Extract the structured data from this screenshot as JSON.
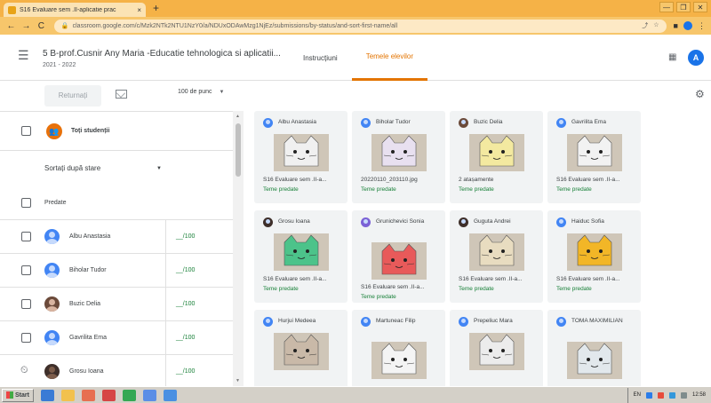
{
  "browser": {
    "tab_title": "S16 Evaluare sem .II-aplicatie prac",
    "tab_close": "×",
    "new_tab": "+",
    "window_controls": [
      "—",
      "❐",
      "✕"
    ],
    "url": "classroom.google.com/c/Mzk2NTk2NTU1NzY0/a/NDUxODAwMzg1NjEz/submissions/by-status/and-sort-first-name/all",
    "nav": [
      "←",
      "→",
      "C"
    ]
  },
  "header": {
    "course_title": "5 B-prof.Cusnir Any Maria -Educatie tehnologica si aplicatii...",
    "course_year": "2021 - 2022",
    "tabs": [
      {
        "label": "Instrucțiuni",
        "active": false
      },
      {
        "label": "Temele elevilor",
        "active": true
      }
    ],
    "avatar_letter": "A",
    "accent_color": "#e37400"
  },
  "toolbar": {
    "return_label": "Returnați",
    "points_value": "100 de punc"
  },
  "left_panel": {
    "all_students_label": "Toți studenții",
    "sort_label": "Sortați după stare",
    "section_label": "Predate",
    "students": [
      {
        "name": "Albu Anastasia",
        "grade": "__/100",
        "avatar": "default"
      },
      {
        "name": "Biholar Tudor",
        "grade": "__/100",
        "avatar": "default"
      },
      {
        "name": "Buzic Delia",
        "grade": "__/100",
        "avatar": "photo"
      },
      {
        "name": "Gavrilita Ema",
        "grade": "__/100",
        "avatar": "default"
      },
      {
        "name": "Grosu Ioana",
        "grade": "__/100",
        "avatar": "dark"
      }
    ]
  },
  "cards": [
    {
      "name": "Albu Anastasia",
      "file": "S16 Evaluare sem .II-a...",
      "status": "Teme predate",
      "avatar": "default",
      "paper": "#f0f0f0"
    },
    {
      "name": "Biholar Tudor",
      "file": "20220110_203110.jpg",
      "status": "Teme predate",
      "avatar": "default",
      "paper": "#e8e0f0"
    },
    {
      "name": "Buzic Delia",
      "file": "2 atașamente",
      "status": "Teme predate",
      "avatar": "photo",
      "paper": "#f3e9a0"
    },
    {
      "name": "Gavrilita Ema",
      "file": "S16 Evaluare sem .II-a...",
      "status": "Teme predate",
      "avatar": "default",
      "paper": "#f2f2f2"
    },
    {
      "name": "Grosu Ioana",
      "file": "S16 Evaluare sem .II-a...",
      "status": "Teme predate",
      "avatar": "dark",
      "paper": "#4cc38a"
    },
    {
      "name": "Grunichevici Sonia",
      "file": "S16 Evaluare sem .II-a...",
      "status": "Teme predate",
      "avatar": "purple",
      "paper": "#e85a5a"
    },
    {
      "name": "Guguta Andrei",
      "file": "S16 Evaluare sem .II-a...",
      "status": "Teme predate",
      "avatar": "dark",
      "paper": "#e8dcc0"
    },
    {
      "name": "Haiduc Sofia",
      "file": "S16 Evaluare sem .II-a...",
      "status": "Teme predate",
      "avatar": "default",
      "paper": "#f2b627"
    },
    {
      "name": "Hurjui Medeea",
      "file": "",
      "status": "",
      "avatar": "default",
      "paper": "#c9b9a8"
    },
    {
      "name": "Martuneac Filip",
      "file": "",
      "status": "",
      "avatar": "default",
      "paper": "#f4f4f4"
    },
    {
      "name": "Prepeliuc Mara",
      "file": "",
      "status": "",
      "avatar": "default",
      "paper": "#ececec"
    },
    {
      "name": "TOMA MAXIMILIAN",
      "file": "",
      "status": "",
      "avatar": "default",
      "paper": "#e2e8ec"
    }
  ],
  "taskbar": {
    "start_label": "Start",
    "language": "EN",
    "time": "12:58"
  }
}
